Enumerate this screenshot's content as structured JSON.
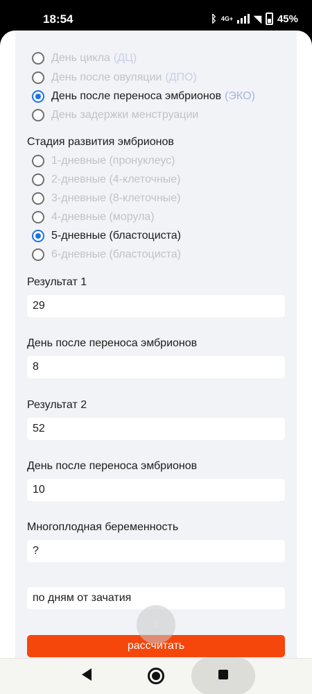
{
  "status": {
    "time": "18:54",
    "network": "4G+",
    "battery": "45%"
  },
  "count_from": {
    "options": [
      {
        "label": "День цикла",
        "abbr": "(ДЦ)",
        "selected": false,
        "disabled": true
      },
      {
        "label": "День после овуляции",
        "abbr": "(ДПО)",
        "selected": false,
        "disabled": true
      },
      {
        "label": "День после переноса эмбрионов",
        "abbr": "(ЭКО)",
        "selected": true,
        "disabled": false
      },
      {
        "label": "День задержки менструации",
        "abbr": "",
        "selected": false,
        "disabled": true
      }
    ]
  },
  "embryo_stage": {
    "title": "Стадия развития эмбрионов",
    "options": [
      {
        "label": "1-дневные (пронуклеус)",
        "selected": false,
        "disabled": true
      },
      {
        "label": "2-дневные (4-клеточные)",
        "selected": false,
        "disabled": true
      },
      {
        "label": "3-дневные (8-клеточные)",
        "selected": false,
        "disabled": true
      },
      {
        "label": "4-дневные (морула)",
        "selected": false,
        "disabled": true
      },
      {
        "label": "5-дневные (бластоциста)",
        "selected": true,
        "disabled": false
      },
      {
        "label": "6-дневные (бластоциста)",
        "selected": false,
        "disabled": true
      }
    ]
  },
  "result1": {
    "label": "Результат 1",
    "value": "29"
  },
  "day1": {
    "label": "День после переноса эмбрионов",
    "value": "8"
  },
  "result2": {
    "label": "Результат 2",
    "value": "52"
  },
  "day2": {
    "label": "День после переноса эмбрионов",
    "value": "10"
  },
  "multiple": {
    "label": "Многоплодная беременность",
    "value": "?"
  },
  "mode": {
    "value": "по дням от зачатия"
  },
  "calculate": {
    "label": "рассчитать"
  },
  "fab": {
    "icon": "up-arrow-icon"
  },
  "navigation": {
    "back_icon": "back-icon",
    "home_icon": "home-icon",
    "recents_icon": "recents-icon"
  }
}
